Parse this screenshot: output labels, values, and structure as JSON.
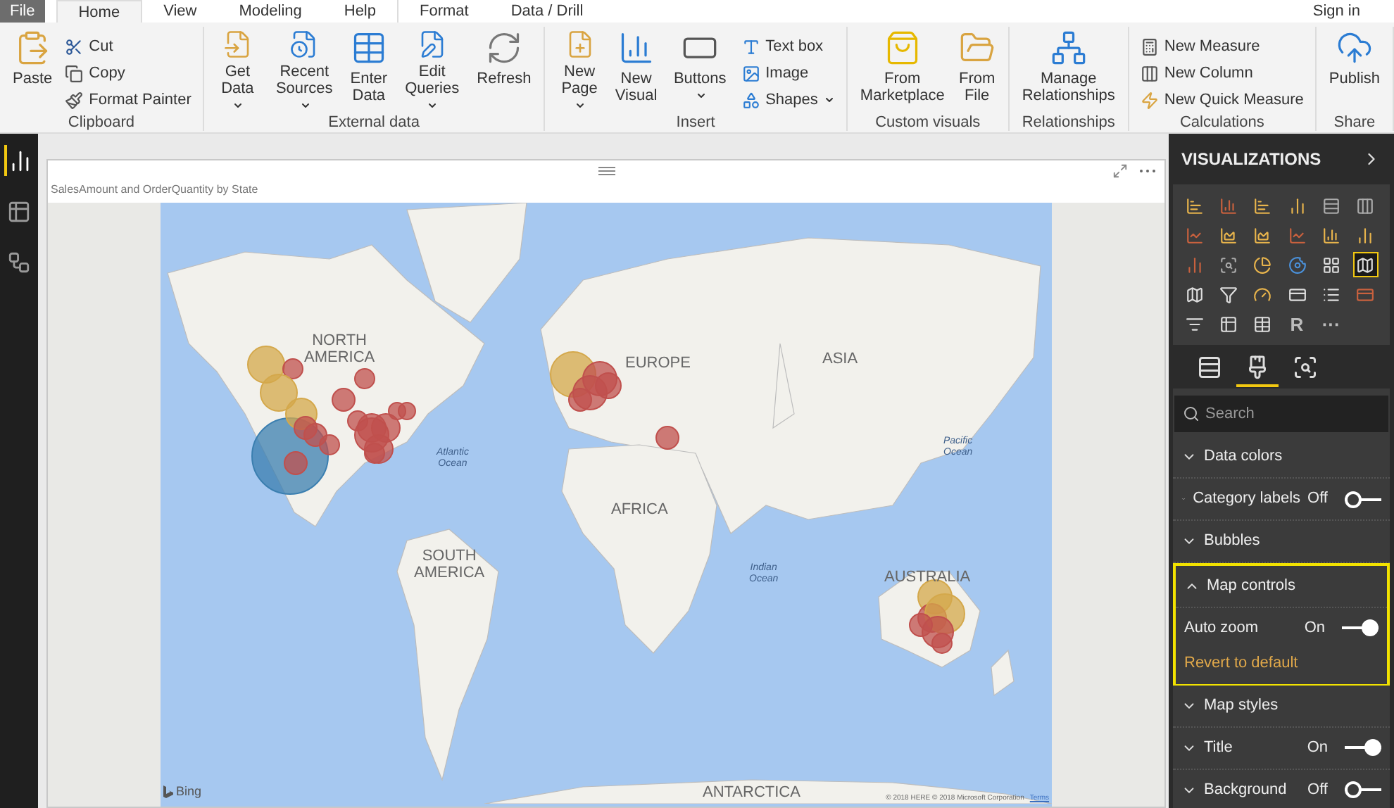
{
  "menu_tabs": [
    {
      "label": "File",
      "kind": "file",
      "selected": false
    },
    {
      "label": "Home",
      "kind": "tab",
      "selected": true
    },
    {
      "label": "View",
      "kind": "tab",
      "selected": false
    },
    {
      "label": "Modeling",
      "kind": "tab",
      "selected": false
    },
    {
      "label": "Help",
      "kind": "tab",
      "selected": false
    },
    {
      "label": "Format",
      "kind": "tab",
      "selected": false
    },
    {
      "label": "Data / Drill",
      "kind": "tab",
      "selected": false
    }
  ],
  "sign_in": "Sign in",
  "ribbon_groups": [
    {
      "name": "Clipboard",
      "items": [
        {
          "label": "Paste",
          "kind": "large",
          "dropdown": false
        },
        {
          "label": "Cut",
          "kind": "small",
          "dropdown": false
        },
        {
          "label": "Copy",
          "kind": "small",
          "dropdown": false
        },
        {
          "label": "Format Painter",
          "kind": "small",
          "dropdown": false
        }
      ]
    },
    {
      "name": "External data",
      "items": [
        {
          "label": "Get\nData",
          "kind": "large",
          "dropdown": true
        },
        {
          "label": "Recent\nSources",
          "kind": "large",
          "dropdown": true
        },
        {
          "label": "Enter\nData",
          "kind": "large",
          "dropdown": false
        },
        {
          "label": "Edit\nQueries",
          "kind": "large",
          "dropdown": true
        },
        {
          "label": "Refresh",
          "kind": "large",
          "dropdown": false
        }
      ]
    },
    {
      "name": "Insert",
      "items": [
        {
          "label": "New\nPage",
          "kind": "large",
          "dropdown": true
        },
        {
          "label": "New\nVisual",
          "kind": "large",
          "dropdown": false
        },
        {
          "label": "Buttons",
          "kind": "large",
          "dropdown": true
        },
        {
          "label": "Text box",
          "kind": "small",
          "dropdown": false
        },
        {
          "label": "Image",
          "kind": "small",
          "dropdown": false
        },
        {
          "label": "Shapes",
          "kind": "small",
          "dropdown": true
        }
      ]
    },
    {
      "name": "Custom visuals",
      "items": [
        {
          "label": "From\nMarketplace",
          "kind": "large",
          "dropdown": false
        },
        {
          "label": "From\nFile",
          "kind": "large",
          "dropdown": false
        }
      ]
    },
    {
      "name": "Relationships",
      "items": [
        {
          "label": "Manage\nRelationships",
          "kind": "large",
          "dropdown": false
        }
      ]
    },
    {
      "name": "Calculations",
      "items": [
        {
          "label": "New Measure",
          "kind": "small",
          "dropdown": false
        },
        {
          "label": "New Column",
          "kind": "small",
          "dropdown": false
        },
        {
          "label": "New Quick Measure",
          "kind": "small",
          "dropdown": false
        }
      ]
    },
    {
      "name": "Share",
      "items": [
        {
          "label": "Publish",
          "kind": "large",
          "dropdown": false
        }
      ]
    }
  ],
  "nav": [
    {
      "selected": true
    },
    {
      "selected": false
    },
    {
      "selected": false
    }
  ],
  "visual": {
    "title": "SalesAmount and OrderQuantity by State",
    "map_labels": [
      {
        "text": "NORTH\nAMERICA",
        "kind": "continent"
      },
      {
        "text": "EUROPE",
        "kind": "continent"
      },
      {
        "text": "ASIA",
        "kind": "continent"
      },
      {
        "text": "AFRICA",
        "kind": "continent"
      },
      {
        "text": "SOUTH\nAMERICA",
        "kind": "continent"
      },
      {
        "text": "AUSTRALIA",
        "kind": "continent"
      },
      {
        "text": "ANTARCTICA",
        "kind": "continent"
      },
      {
        "text": "Atlantic\nOcean",
        "kind": "ocean"
      },
      {
        "text": "Pacific\nOcean",
        "kind": "ocean"
      },
      {
        "text": "Indian\nOcean",
        "kind": "ocean"
      }
    ],
    "bing": "Bing",
    "attribution": "© 2018 HERE © 2018 Microsoft Corporation",
    "terms": "Terms"
  },
  "pane": {
    "title": "VISUALIZATIONS",
    "gallery": [
      {
        "selected": false
      },
      {
        "selected": false
      },
      {
        "selected": false
      },
      {
        "selected": false
      },
      {
        "selected": false
      },
      {
        "selected": false
      },
      {
        "selected": false
      },
      {
        "selected": false
      },
      {
        "selected": false
      },
      {
        "selected": false
      },
      {
        "selected": false
      },
      {
        "selected": false
      },
      {
        "selected": false
      },
      {
        "selected": false
      },
      {
        "selected": false
      },
      {
        "selected": false
      },
      {
        "selected": false
      },
      {
        "selected": true
      },
      {
        "selected": false
      },
      {
        "selected": false
      },
      {
        "selected": false
      },
      {
        "selected": false
      },
      {
        "selected": false
      },
      {
        "selected": false
      },
      {
        "selected": false
      },
      {
        "selected": false
      },
      {
        "selected": false
      },
      {
        "label": "R",
        "selected": false
      },
      {
        "label": "···",
        "selected": false
      }
    ],
    "tabs": [
      {
        "selected": false
      },
      {
        "selected": true
      },
      {
        "selected": false
      }
    ],
    "search": {
      "placeholder": "Search"
    },
    "sections": [
      {
        "title": "Data colors",
        "expanded": false,
        "highlighted": false
      },
      {
        "title": "Category labels",
        "expanded": false,
        "highlighted": false,
        "toggle": {
          "label": "Off",
          "on": false
        }
      },
      {
        "title": "Bubbles",
        "expanded": false,
        "highlighted": false
      },
      {
        "title": "Map controls",
        "expanded": true,
        "highlighted": true,
        "rows": [
          {
            "label": "Auto zoom",
            "toggle": {
              "label": "On",
              "on": true
            }
          }
        ],
        "link": "Revert to default"
      },
      {
        "title": "Map styles",
        "expanded": false,
        "highlighted": false
      },
      {
        "title": "Title",
        "expanded": false,
        "highlighted": false,
        "toggle": {
          "label": "On",
          "on": true
        }
      },
      {
        "title": "Background",
        "expanded": false,
        "highlighted": false,
        "toggle": {
          "label": "Off",
          "on": false
        }
      }
    ]
  }
}
